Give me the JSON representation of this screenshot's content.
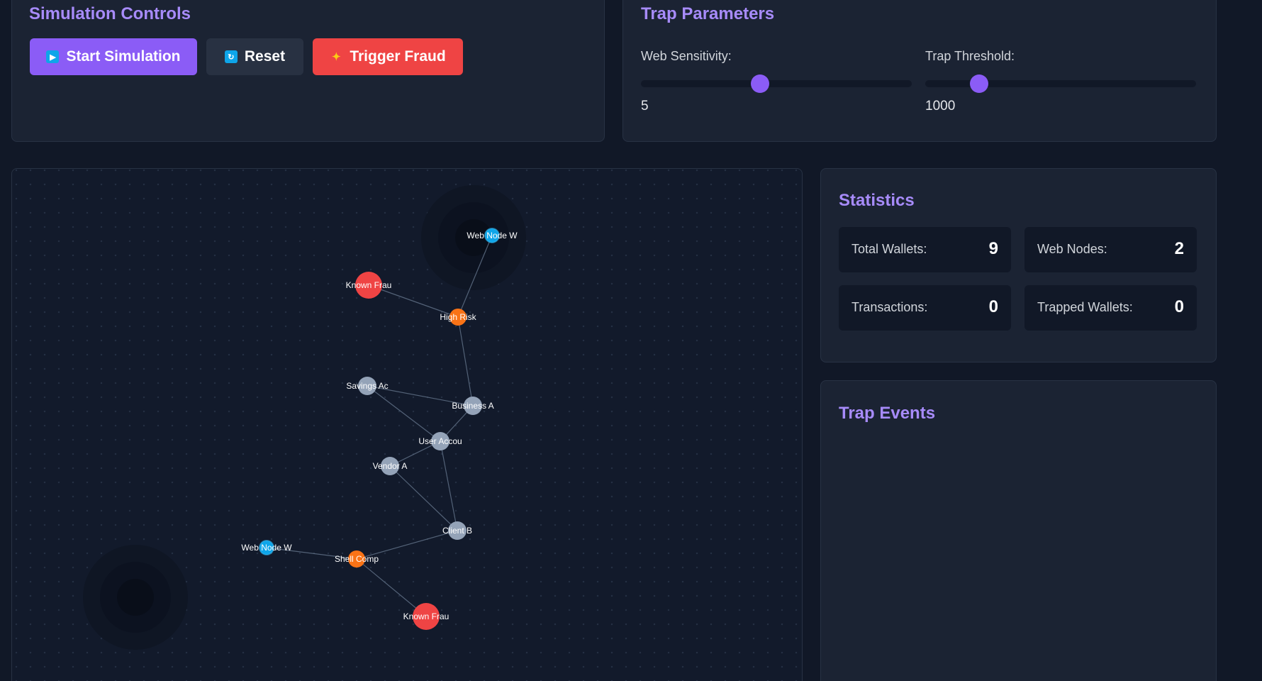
{
  "simulation": {
    "title": "Simulation Controls",
    "buttons": {
      "start": "Start Simulation",
      "reset": "Reset",
      "trigger": "Trigger Fraud"
    }
  },
  "trap_parameters": {
    "title": "Trap Parameters",
    "web_sensitivity": {
      "label": "Web Sensitivity:",
      "value": "5",
      "level": 0.44
    },
    "trap_threshold": {
      "label": "Trap Threshold:",
      "value": "1000",
      "level": 0.2
    }
  },
  "graph": {
    "nodes": [
      {
        "id": "webA",
        "label": "Web Node W",
        "kind": "web"
      },
      {
        "id": "fraudA",
        "label": "Known Frau",
        "kind": "fraud"
      },
      {
        "id": "highrisk",
        "label": "High Risk",
        "kind": "risk"
      },
      {
        "id": "savings",
        "label": "Savings Ac",
        "kind": "normal"
      },
      {
        "id": "business",
        "label": "Business A",
        "kind": "normal"
      },
      {
        "id": "user",
        "label": "User Accou",
        "kind": "normal"
      },
      {
        "id": "vendor",
        "label": "Vendor A",
        "kind": "normal"
      },
      {
        "id": "clientb",
        "label": "Client B",
        "kind": "normal"
      },
      {
        "id": "webB",
        "label": "Web Node W",
        "kind": "web"
      },
      {
        "id": "shell",
        "label": "Shell Comp",
        "kind": "risk"
      },
      {
        "id": "fraudB",
        "label": "Known Frau",
        "kind": "fraud"
      }
    ],
    "edges": [
      [
        "webA",
        "highrisk"
      ],
      [
        "fraudA",
        "highrisk"
      ],
      [
        "highrisk",
        "business"
      ],
      [
        "savings",
        "business"
      ],
      [
        "savings",
        "user"
      ],
      [
        "business",
        "user"
      ],
      [
        "user",
        "vendor"
      ],
      [
        "user",
        "clientb"
      ],
      [
        "vendor",
        "clientb"
      ],
      [
        "clientb",
        "shell"
      ],
      [
        "webB",
        "shell"
      ],
      [
        "shell",
        "fraudB"
      ]
    ],
    "colors": {
      "web": "#0ea5e9",
      "fraud": "#ef4444",
      "risk": "#f97316",
      "normal": "#94a3b8",
      "edge": "#64748b"
    }
  },
  "statistics": {
    "title": "Statistics",
    "total_wallets": {
      "label": "Total Wallets:",
      "value": "9"
    },
    "web_nodes": {
      "label": "Web Nodes:",
      "value": "2"
    },
    "transactions": {
      "label": "Transactions:",
      "value": "0"
    },
    "trapped_wallets": {
      "label": "Trapped Wallets:",
      "value": "0"
    }
  },
  "trap_events": {
    "title": "Trap Events"
  }
}
